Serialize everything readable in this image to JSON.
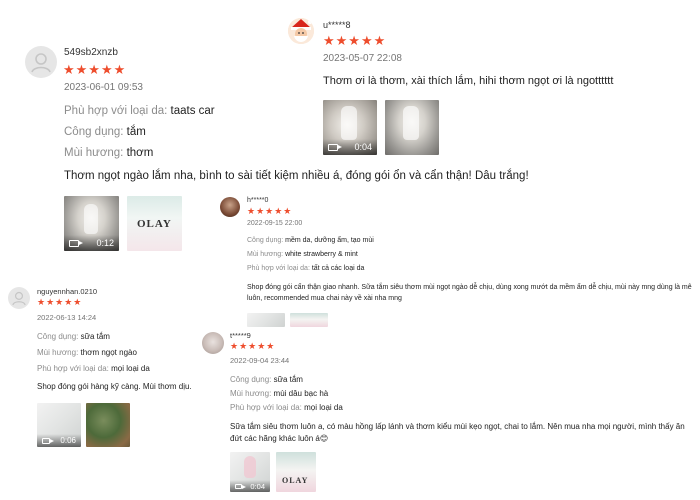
{
  "reviews": [
    {
      "username": "549sb2xnzb",
      "stars": "★★★★★",
      "date": "2023-06-01 09:53",
      "fields": [
        {
          "label": "Phù hợp với loại da:",
          "value": "taats car"
        },
        {
          "label": "Công dụng:",
          "value": "tắm"
        },
        {
          "label": "Mùi hương:",
          "value": "thơm"
        }
      ],
      "text": "Thơm ngọt ngào lắm nha, bình to sài tiết kiệm nhiều á, đóng gói ổn và cẩn thận! Dâu trắng!",
      "video_duration": "0:12",
      "olay_label": "OLAY"
    },
    {
      "username": "u*****8",
      "stars": "★★★★★",
      "date": "2023-05-07 22:08",
      "text": "Thơm ơi là thơm, xài thích lắm, hihi thơm ngọt ơi là ngotttttt",
      "video_duration": "0:04"
    },
    {
      "username": "h*****0",
      "stars": "★★★★★",
      "date": "2022-09-15 22:00",
      "fields": [
        {
          "label": "Công dụng:",
          "value": "mềm da, dưỡng ẩm, tạo mùi"
        },
        {
          "label": "Mùi hương:",
          "value": "white strawberry & mint"
        },
        {
          "label": "Phù hợp với loại da:",
          "value": "tất cả các loại da"
        }
      ],
      "text": "Shop đóng gói cẩn thận giao nhanh. Sữa tắm siêu thơm mùi ngọt ngào dễ chịu, dùng xong mướt da mềm ẩm dễ chịu, mùi này mng dùng là mê luôn, recommended mua chai này về xài nha mng"
    },
    {
      "username": "nguyennhan.0210",
      "stars": "★★★★★",
      "date": "2022-06-13 14:24",
      "fields": [
        {
          "label": "Công dụng:",
          "value": "sữa tắm"
        },
        {
          "label": "Mùi hương:",
          "value": "thơm ngọt ngào"
        },
        {
          "label": "Phù hợp với loại da:",
          "value": "mọi loại da"
        }
      ],
      "text": "Shop đóng gói hàng kỹ càng. Mùi thơm dịu.",
      "video_duration": "0:06"
    },
    {
      "username": "t*****9",
      "stars": "★★★★★",
      "date": "2022-09-04 23:44",
      "fields": [
        {
          "label": "Công dụng:",
          "value": "sữa tắm"
        },
        {
          "label": "Mùi hương:",
          "value": "mùi dâu bạc hà"
        },
        {
          "label": "Phù hợp với loại da:",
          "value": "mọi loại da"
        }
      ],
      "text": "Sữa tắm siêu thơm luôn a, có màu hồng lấp lánh và thơm kiểu mùi kẹo ngọt, chai to lắm. Nên mua nha mọi người, mình thấy ăn đứt các hãng khác luôn á😊",
      "video_duration": "0:04",
      "olay_label": "OLAY"
    }
  ]
}
